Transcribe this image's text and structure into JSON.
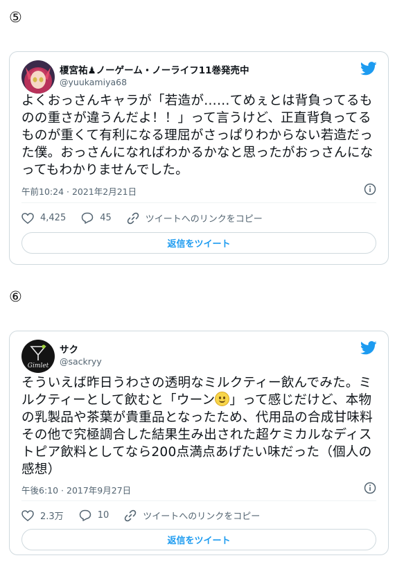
{
  "tweets": [
    {
      "number": "⑤",
      "author": "榎宮祐♟ノーゲーム・ノーライフ11巻発売中",
      "handle": "@yuukamiya68",
      "text": "よくおっさんキャラが「若造が……てめぇとは背負ってるものの重さが違うんだよ！！」って言うけど、正直背負ってるものが重くて有利になる理屈がさっぱりわからない若造だった僕。おっさんになればわかるかなと思ったがおっさんになってもわかりませんでした。",
      "timestamp": "午前10:24 · 2021年2月21日",
      "likes": "4,425",
      "replies": "45",
      "copy_link": "ツイートへのリンクをコピー",
      "reply_button": "返信をツイート",
      "icons": [
        "twitter-bird-icon",
        "info-icon",
        "heart-icon",
        "reply-icon",
        "link-icon"
      ]
    },
    {
      "number": "⑥",
      "author": "サク",
      "handle": "@sackryy",
      "text_before": "そういえば昨日うわさの透明なミルクティー飲んでみた。ミルクティーとして飲むと「ウーン",
      "emoji": "slightly-smiling-face",
      "text_after": "」って感じだけど、本物の乳製品や茶葉が貴重品となったため、代用品の合成甘味料その他で究極調合した結果生み出された超ケミカルなディストピア飲料としてなら200点満点あげたい味だった（個人の感想）",
      "timestamp": "午後6:10 · 2017年9月27日",
      "likes": "2.3万",
      "replies": "10",
      "copy_link": "ツイートへのリンクをコピー",
      "reply_button": "返信をツイート",
      "avatar_text": "Gimlet",
      "icons": [
        "twitter-bird-icon",
        "info-icon",
        "heart-icon",
        "reply-icon",
        "link-icon"
      ]
    }
  ],
  "colors": {
    "accent": "#1d9bf0",
    "secondary_text": "#536471",
    "border": "#cfd9de"
  }
}
